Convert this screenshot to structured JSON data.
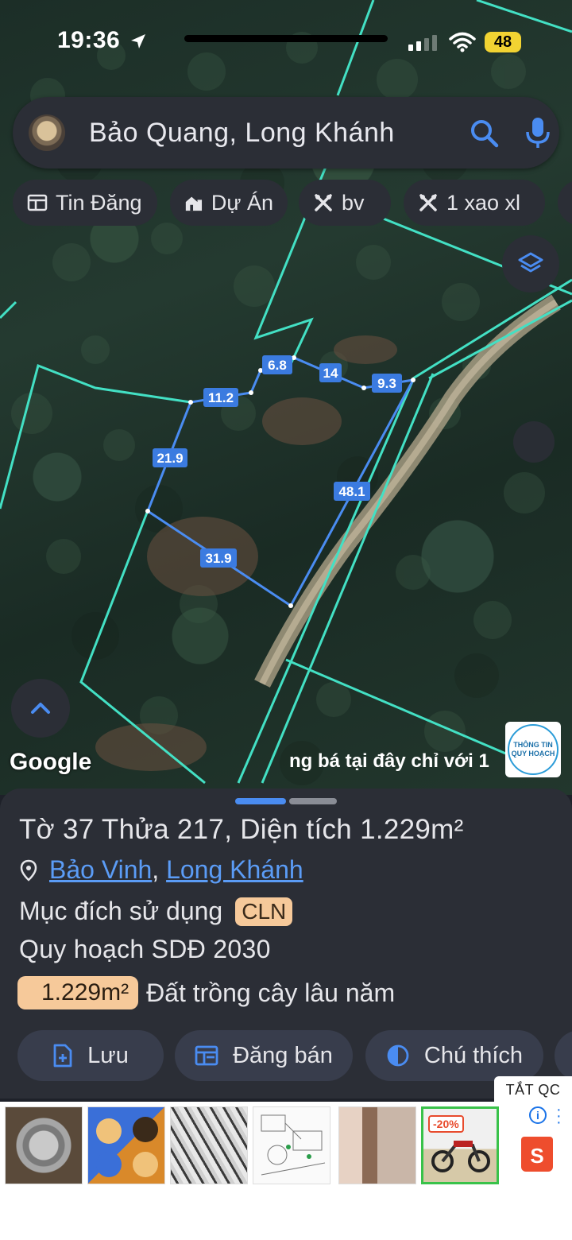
{
  "status": {
    "time": "19:36",
    "battery": "48"
  },
  "search": {
    "query": "Bảo Quang, Long Khánh"
  },
  "chips": [
    {
      "label": "Tin Đăng",
      "icon": "listing-icon"
    },
    {
      "label": "Dự Án",
      "icon": "building-icon"
    },
    {
      "label": "bv",
      "icon": "tools-icon"
    },
    {
      "label": "1 xao xl",
      "icon": "tools-icon"
    }
  ],
  "map": {
    "parcel_edges": [
      "21.9",
      "11.2",
      "6.8",
      "14",
      "9.3",
      "48.1",
      "31.9"
    ],
    "google_label": "Google",
    "ad_marquee": "ng bá tại đây chỉ với 1",
    "logo_text_1": "THÔNG TIN",
    "logo_text_2": "QUY HOẠCH"
  },
  "parcel": {
    "title_prefix": "Tờ",
    "sheet_no": "37",
    "plot_word": "Thửa",
    "plot_no": "217",
    "area_word": ", Diện tích",
    "area": "1.229m²",
    "ward": "Bảo Vinh",
    "separator": ",",
    "city": "Long Khánh",
    "purpose_label": "Mục đích sử dụng",
    "purpose_code": "CLN",
    "plan_label": "Quy hoạch SDĐ 2030",
    "plan_area": "1.229m²",
    "plan_desc": "Đất trồng cây lâu năm"
  },
  "actions": [
    {
      "label": "Lưu",
      "icon": "add-doc-icon"
    },
    {
      "label": "Đăng bán",
      "icon": "post-icon"
    },
    {
      "label": "Chú thích",
      "icon": "legend-icon"
    }
  ],
  "ad": {
    "close_label": "TẮT QC",
    "discount": "-20%",
    "info": "i",
    "shopee": "S"
  },
  "colors": {
    "accent": "#5b9cf6",
    "badge": "#f6c99a",
    "panel": "#2b2e36",
    "parcel_line": "#4a8cf1",
    "boundary": "#43e0c4"
  }
}
